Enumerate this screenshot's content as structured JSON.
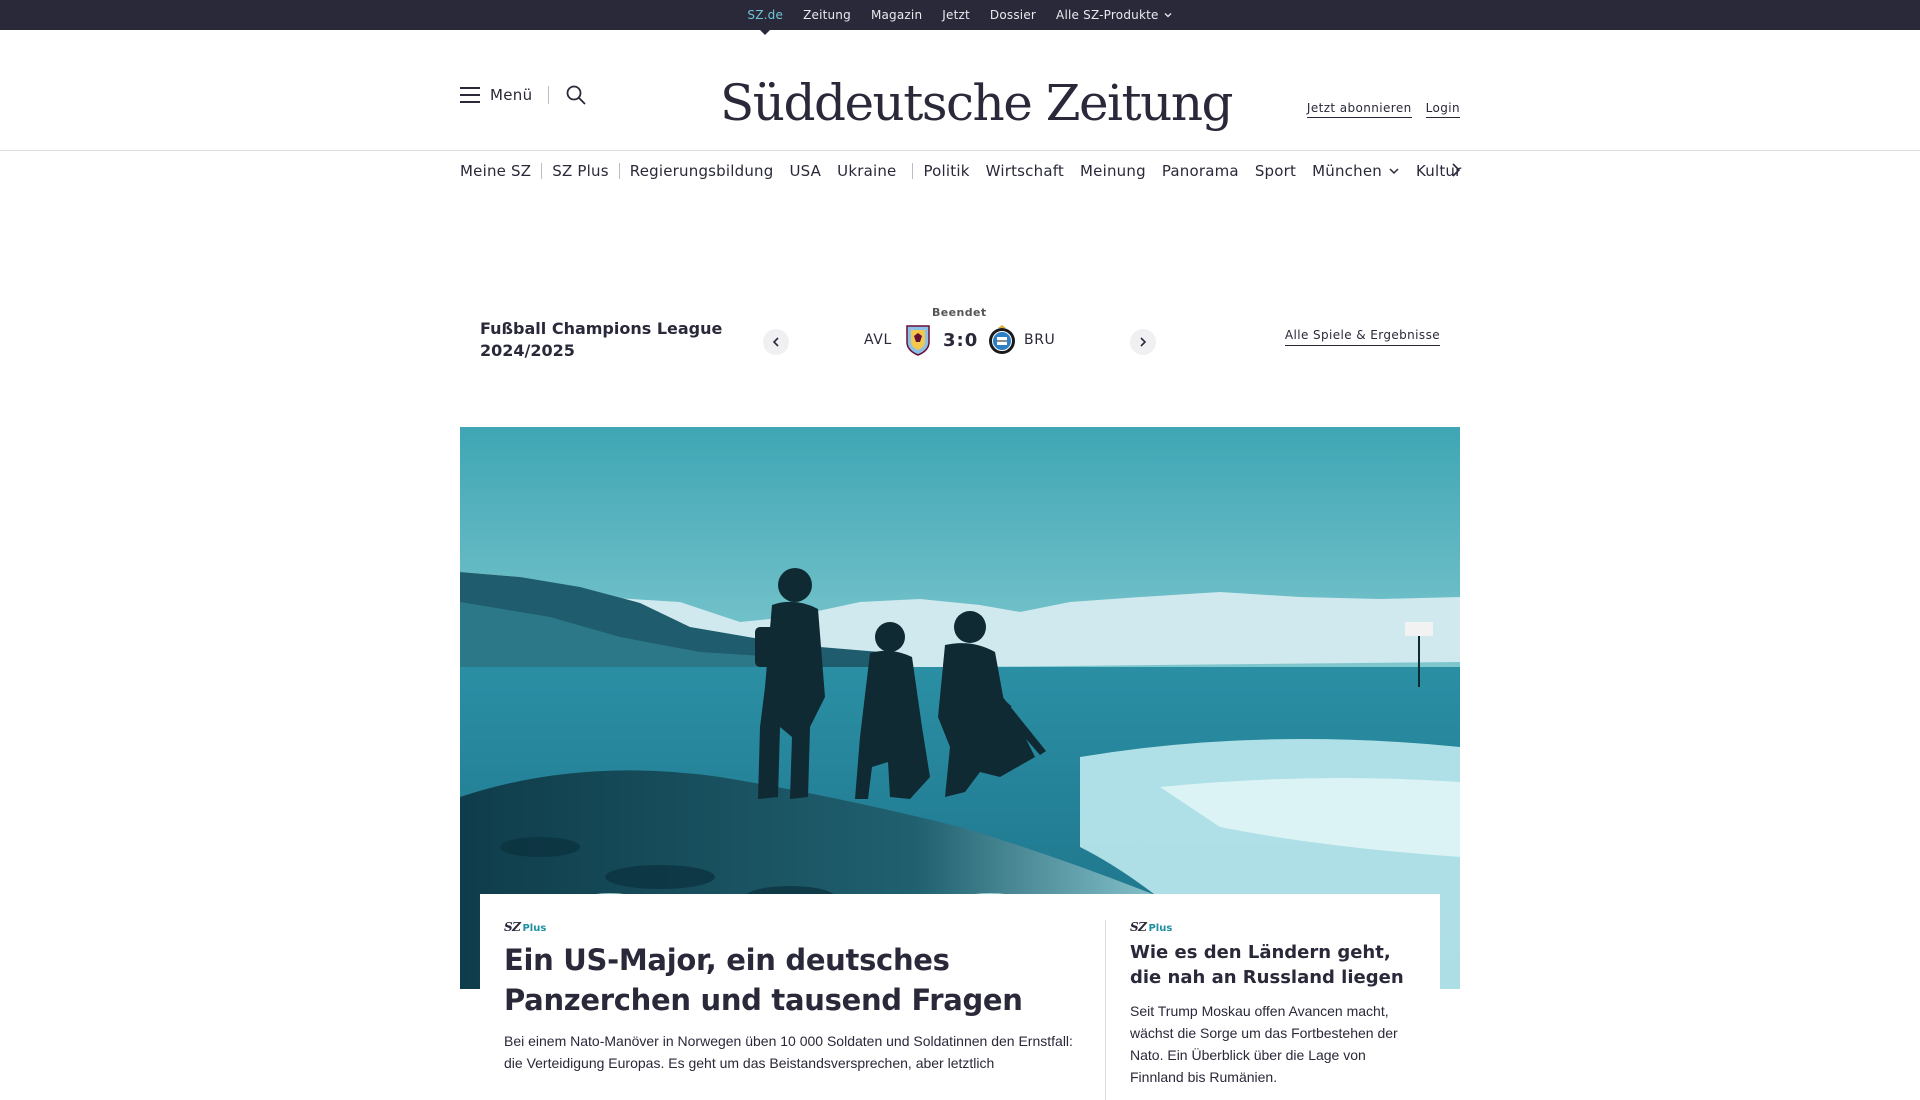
{
  "topbar": {
    "items": [
      {
        "label": "SZ.de"
      },
      {
        "label": "Zeitung"
      },
      {
        "label": "Magazin"
      },
      {
        "label": "Jetzt"
      },
      {
        "label": "Dossier"
      },
      {
        "label": "Alle SZ-Produkte"
      }
    ],
    "active_color": "#71c4d6"
  },
  "header": {
    "menu_label": "Menü",
    "logo_text": "Süddeutsche Zeitung",
    "subscribe_label": "Jetzt abonnieren",
    "login_label": "Login"
  },
  "nav": {
    "items": [
      {
        "label": "Meine SZ"
      },
      {
        "label": "SZ Plus"
      },
      {
        "label": "Regierungsbildung"
      },
      {
        "label": "USA"
      },
      {
        "label": "Ukraine"
      },
      {
        "label": "Politik"
      },
      {
        "label": "Wirtschaft"
      },
      {
        "label": "Meinung"
      },
      {
        "label": "Panorama"
      },
      {
        "label": "Sport"
      },
      {
        "label": "München"
      },
      {
        "label": "Kultur"
      }
    ]
  },
  "score": {
    "competition_line1": "Fußball Champions League",
    "competition_line2": "2024/2025",
    "status": "Beendet",
    "home_team": "AVL",
    "away_team": "BRU",
    "result": "3:0",
    "all_link": "Alle Spiele & Ergebnisse"
  },
  "articles": {
    "main": {
      "sz": "SZ",
      "plus": "Plus",
      "headline_line1": "Ein US-Major, ein deutsches",
      "headline_line2": "Panzerchen und tausend Fragen",
      "teaser": "Bei einem Nato-Manöver in Norwegen üben 10 000 Soldaten und Soldatinnen den Ernstfall: die Verteidigung Europas. Es geht um das Beistandsversprechen, aber letztlich"
    },
    "side": {
      "sz": "SZ",
      "plus": "Plus",
      "headline": "Wie es den Ländern geht, die nah an Russland liegen",
      "teaser": "Seit Trump Moskau offen Avancen macht, wächst die Sorge um das Fortbestehen der Nato. Ein Überblick über die Lage von Finnland bis Rumänien."
    }
  },
  "colors": {
    "topbar_bg": "#29293a",
    "text": "#29293a",
    "accent": "#1d8fa3"
  }
}
